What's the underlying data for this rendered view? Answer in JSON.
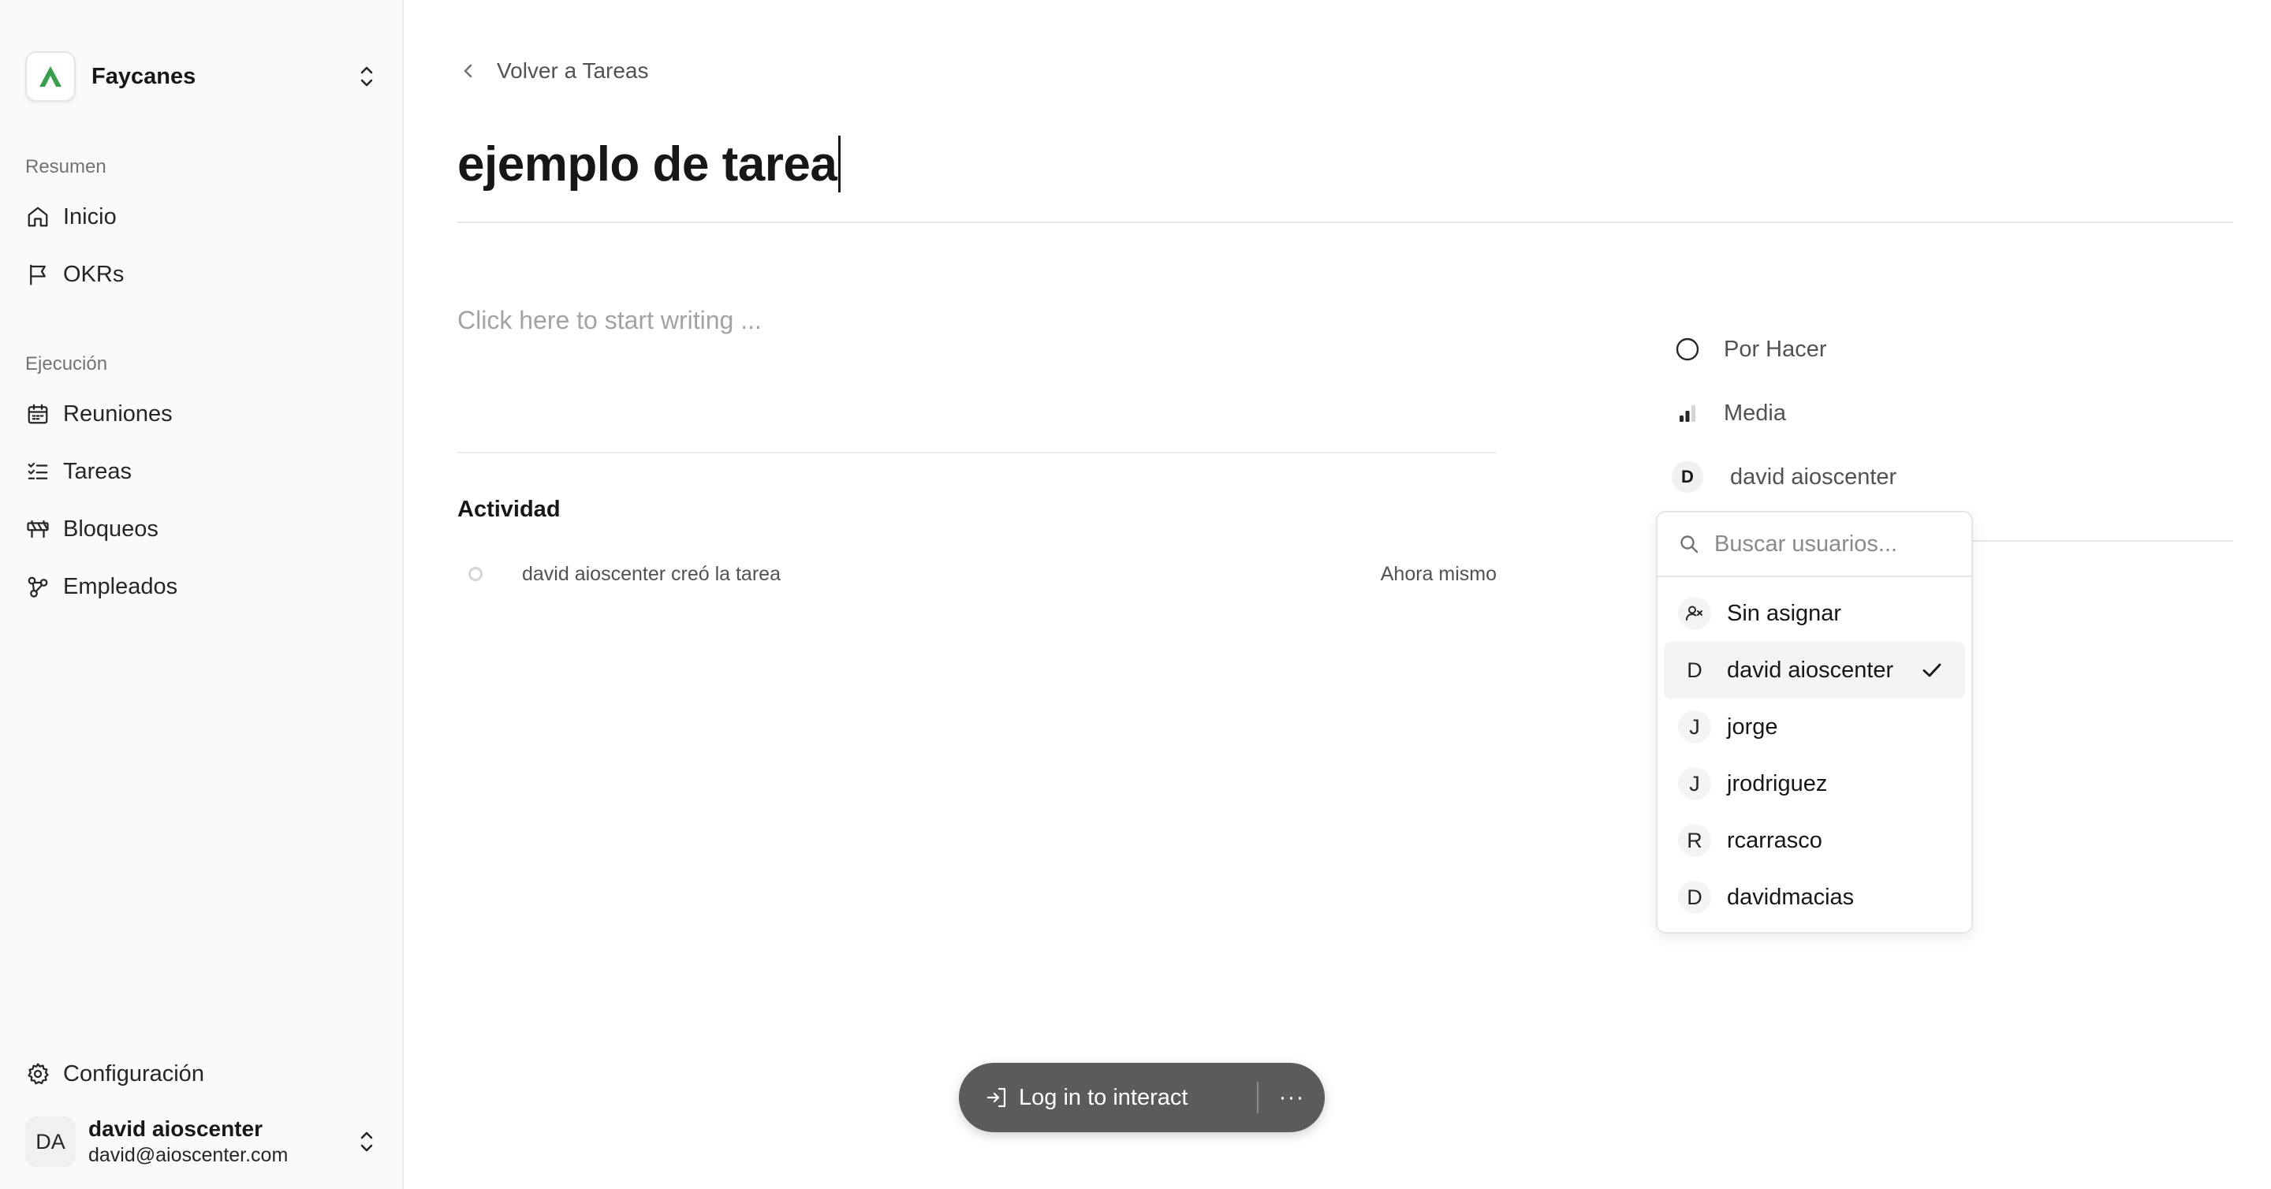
{
  "workspace": {
    "name": "Faycanes"
  },
  "sidebar": {
    "groups": [
      {
        "label": "Resumen",
        "items": [
          {
            "label": "Inicio",
            "icon": "home-icon"
          },
          {
            "label": "OKRs",
            "icon": "flag-icon"
          }
        ]
      },
      {
        "label": "Ejecución",
        "items": [
          {
            "label": "Reuniones",
            "icon": "calendar-icon"
          },
          {
            "label": "Tareas",
            "icon": "list-checks-icon"
          },
          {
            "label": "Bloqueos",
            "icon": "barrier-icon"
          },
          {
            "label": "Empleados",
            "icon": "network-icon"
          }
        ]
      }
    ],
    "settings_label": "Configuración",
    "user": {
      "initials": "DA",
      "name": "david aioscenter",
      "email": "david@aioscenter.com"
    }
  },
  "main": {
    "back_label": "Volver a Tareas",
    "title": "ejemplo de tarea",
    "editor_placeholder": "Click here to start writing ...",
    "activity": {
      "title": "Actividad",
      "entries": [
        {
          "text": "david aioscenter creó la tarea",
          "time": "Ahora mismo"
        }
      ]
    }
  },
  "properties": {
    "status": "Por Hacer",
    "priority": "Media",
    "assignee": {
      "initial": "D",
      "name": "david aioscenter"
    }
  },
  "assignee_dropdown": {
    "search_placeholder": "Buscar usuarios...",
    "unassigned_label": "Sin asignar",
    "users": [
      {
        "initial": "D",
        "name": "david aioscenter",
        "selected": true
      },
      {
        "initial": "J",
        "name": "jorge",
        "selected": false
      },
      {
        "initial": "J",
        "name": "jrodriguez",
        "selected": false
      },
      {
        "initial": "R",
        "name": "rcarrasco",
        "selected": false
      },
      {
        "initial": "D",
        "name": "davidmacias",
        "selected": false
      }
    ]
  },
  "overlay": {
    "login_label": "Log in to interact",
    "more_label": "···"
  },
  "colors": {
    "logo_green": "#3a9d4a",
    "text": "#171717",
    "muted": "#737373",
    "pill_bg": "#5b5b5b"
  }
}
